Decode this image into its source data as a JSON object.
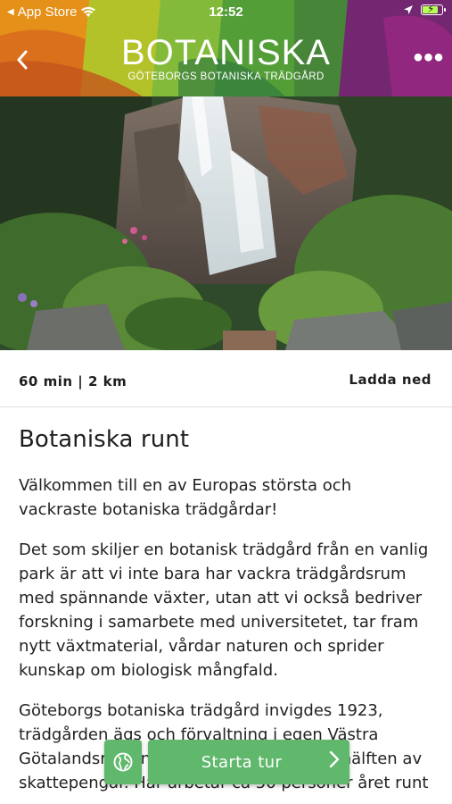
{
  "status_bar": {
    "carrier": "App Store",
    "time": "12:52",
    "icons": [
      "back-triangle-icon",
      "wifi-icon",
      "location-arrow-icon",
      "battery-charging-icon"
    ]
  },
  "header": {
    "back_icon": "chevron-left-icon",
    "logo_title": "BOTANISKA",
    "logo_subtitle": "GÖTEBORGS BOTANISKA TRÄDGÅRD",
    "more_icon": "more-dots-icon",
    "more_glyph": "•••",
    "colors": [
      "#f39a1b",
      "#c8d32a",
      "#69b640",
      "#7b2a78",
      "#d6208b"
    ]
  },
  "tour": {
    "meta": "60 min | 2 km",
    "download_label": "Ladda ned",
    "title": "Botaniska runt",
    "paragraphs": [
      "Välkommen till en av Europas största och vackraste botaniska trädgårdar!",
      "Det som skiljer en botanisk trädgård från en vanlig park är att vi inte bara har vackra trädgårdsrum med spännande växter, utan att vi också bedriver forskning i samarbete med universitetet, tar fram nytt växtmaterial, vårdar naturen och sprider kunskap om biologisk mångfald.",
      "Göteborgs botaniska trädgård invigdes 1923, trädgården ägs och förvaltning i egen Västra Götalandsregionen och drivs till mer än hälften av skattepengar. Här arbetar ca 50 personer året runt"
    ]
  },
  "actions": {
    "language_icon": "globe-icon",
    "start_label": "Starta tur",
    "start_icon": "chevron-right-icon",
    "accent": "#5fb86b"
  }
}
